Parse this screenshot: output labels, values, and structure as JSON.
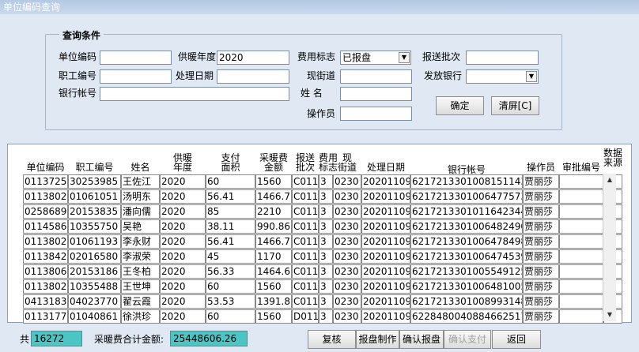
{
  "window": {
    "title": "单位编码查询"
  },
  "query": {
    "group_title": "查询条件",
    "unit_code_label": "单位编码",
    "unit_code_value": "",
    "heating_year_label": "供暖年度",
    "heating_year_value": "2020",
    "fee_flag_label": "费用标志",
    "fee_flag_value": "已报盘",
    "batch_label": "报送批次",
    "batch_value": "",
    "employee_no_label": "职工编号",
    "employee_no_value": "",
    "process_date_label": "处理日期",
    "process_date_value": "",
    "current_street_label": "现街道",
    "current_street_value": "",
    "bank_label": "发放银行",
    "bank_value": "",
    "account_label": "银行帐号",
    "account_value": "",
    "name_label": "姓    名",
    "name_value": "",
    "operator_label": "操作员",
    "operator_value": "",
    "confirm_button": "确定",
    "clear_button": "清屏[C]"
  },
  "table": {
    "headers": [
      "单位编码",
      "职工编号",
      "姓名",
      "供暖\n年度",
      "支付\n面积",
      "采暖费\n金额",
      "报送\n批次",
      "费用\n标志",
      "现\n街道",
      "处理日期",
      "银行帐号",
      "操作员",
      "审批编号",
      "数据\n来源"
    ],
    "rows": [
      [
        "0113725",
        "30253985",
        "王佐江",
        "2020",
        "60",
        "1560",
        "C011",
        "3",
        "0230",
        "20201109",
        "6217213301008151143",
        "贾丽莎",
        "",
        ""
      ],
      [
        "0113802",
        "01061051",
        "汤明东",
        "2020",
        "56.41",
        "1466.7",
        "C011",
        "3",
        "0230",
        "20201109",
        "6217213301006477573",
        "贾丽莎",
        "",
        ""
      ],
      [
        "0258689",
        "20153835",
        "潘向儒",
        "2020",
        "85",
        "2210",
        "C011",
        "3",
        "0230",
        "20201109",
        "6217213301011642344",
        "贾丽莎",
        "",
        ""
      ],
      [
        "0114586",
        "10355750",
        "吴艳",
        "2020",
        "38.11",
        "990.86",
        "C011",
        "3",
        "0230",
        "20201109",
        "6217213301006482490",
        "贾丽莎",
        "",
        ""
      ],
      [
        "0113802",
        "01061193",
        "李永财",
        "2020",
        "56.41",
        "1466.7",
        "C011",
        "3",
        "0230",
        "20201109",
        "6217213301006478498",
        "贾丽莎",
        "",
        ""
      ],
      [
        "0113842",
        "02016580",
        "李淑荣",
        "2020",
        "45",
        "1170",
        "C011",
        "3",
        "0230",
        "20201109",
        "6217213301006474539",
        "贾丽莎",
        "",
        ""
      ],
      [
        "0113806",
        "20153186",
        "王冬柏",
        "2020",
        "56.33",
        "1464.6",
        "C011",
        "3",
        "0230",
        "20201109",
        "6217213301005549125",
        "贾丽莎",
        "",
        ""
      ],
      [
        "0113802",
        "10355488",
        "王世坤",
        "2020",
        "60",
        "1560",
        "C011",
        "3",
        "0230",
        "20201109",
        "6217213301006481005",
        "贾丽莎",
        "",
        ""
      ],
      [
        "0413183",
        "04023770",
        "翟云霞",
        "2020",
        "53.53",
        "1391.8",
        "C011",
        "3",
        "0230",
        "20201109",
        "6217213301008993148",
        "贾丽莎",
        "",
        ""
      ],
      [
        "0113177",
        "01040861",
        "徐洪珍",
        "2020",
        "60",
        "1560",
        "D011",
        "3",
        "0230",
        "20201109",
        "6228480040884662517",
        "贾丽莎",
        "",
        ""
      ]
    ]
  },
  "footer": {
    "count_label": "共",
    "count_value": "16272",
    "total_label": "采暖费合计金额:",
    "total_value": "25448606.26",
    "buttons": [
      "复核",
      "报盘制作",
      "确认报盘",
      "确认支付",
      "返回"
    ]
  }
}
